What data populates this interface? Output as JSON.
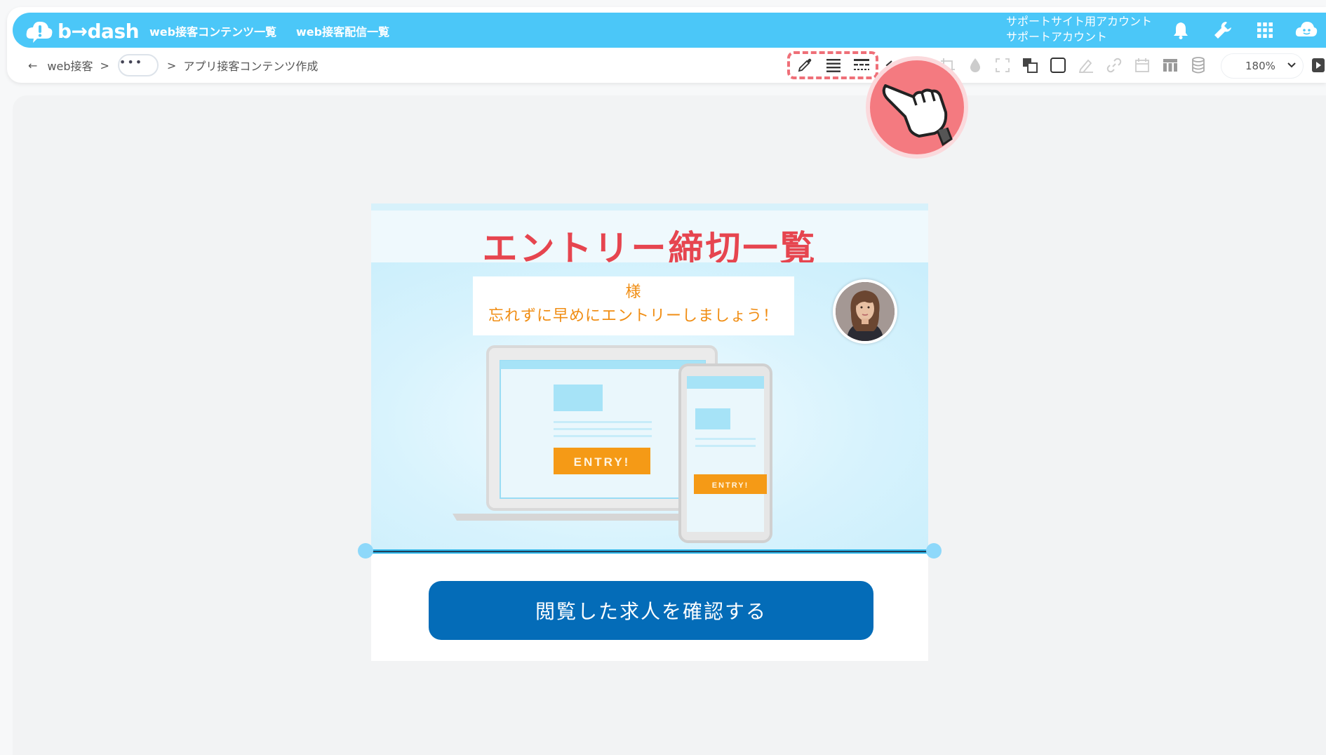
{
  "app": {
    "logo_text": "b→dash",
    "nav": [
      "web接客コンテンツ一覧",
      "web接客配信一覧"
    ],
    "account_line1": "サポートサイト用アカウント",
    "account_line2": "サポートアカウント"
  },
  "breadcrumb": {
    "back": "←",
    "root": "web接客",
    "sep": ">",
    "more": "•••",
    "current": "アプリ接客コンテンツ作成"
  },
  "toolbar": {
    "zoom_value": "180%"
  },
  "email": {
    "title": "エントリー締切一覧",
    "message_line1": "様",
    "message_line2": "忘れずに早めにエントリーしましょう！",
    "entry_label": "ENTRY!",
    "cta_label": "閲覧した求人を確認する"
  },
  "colors": {
    "brand": "#4bc7f8",
    "title_red": "#e6454f",
    "message_orange": "#f08d13",
    "cta_blue": "#046cb8",
    "highlight": "#ef6f78"
  }
}
